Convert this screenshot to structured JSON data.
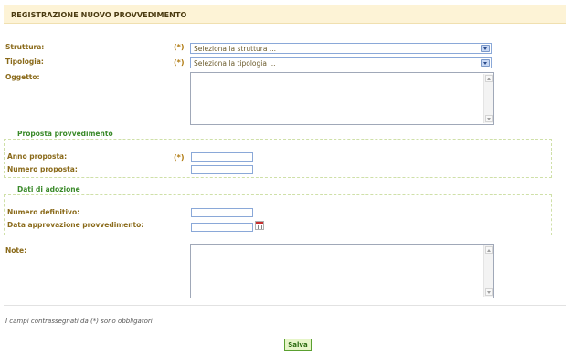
{
  "header": {
    "title": "REGISTRAZIONE NUOVO PROVVEDIMENTO"
  },
  "required_marker": "(*)",
  "struttura": {
    "label": "Struttura:",
    "value": "Seleziona la struttura ..."
  },
  "tipologia": {
    "label": "Tipologia:",
    "value": "Seleziona la tipologia ..."
  },
  "oggetto": {
    "label": "Oggetto:",
    "value": ""
  },
  "proposta": {
    "legend": "Proposta provvedimento",
    "anno_label": "Anno proposta:",
    "anno_value": "",
    "numero_label": "Numero proposta:",
    "numero_value": ""
  },
  "adozione": {
    "legend": "Dati di adozione",
    "numero_label": "Numero definitivo:",
    "numero_value": "",
    "data_label": "Data approvazione provvedimento:",
    "data_value": ""
  },
  "note": {
    "label": "Note:",
    "value": ""
  },
  "footer": {
    "required_note": "I campi contrassegnati da (*) sono obbligatori",
    "save_label": "Salva"
  }
}
